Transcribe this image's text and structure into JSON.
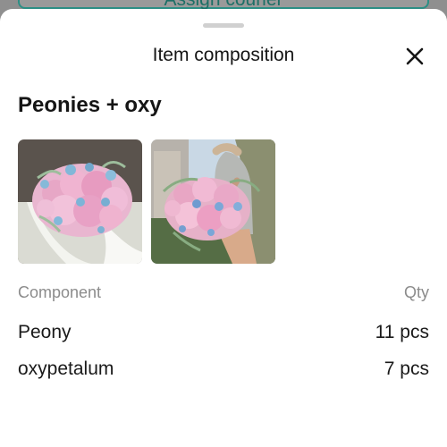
{
  "backdrop": {
    "action_label": "Assign courier"
  },
  "sheet": {
    "title": "Item composition",
    "item_name": "Peonies + oxy",
    "close_icon": "close-icon"
  },
  "photos": [
    "bouquet-photo-1",
    "bouquet-photo-2"
  ],
  "table": {
    "header": {
      "component": "Component",
      "qty": "Qty"
    },
    "rows": [
      {
        "component": "Peony",
        "qty": "11 pcs"
      },
      {
        "component": "oxypetalum",
        "qty": "7 pcs"
      }
    ]
  },
  "colors": {
    "accent": "#2c8f85",
    "text": "#151515",
    "muted": "#8c8c8c",
    "backdrop": "#8f8f8f"
  }
}
